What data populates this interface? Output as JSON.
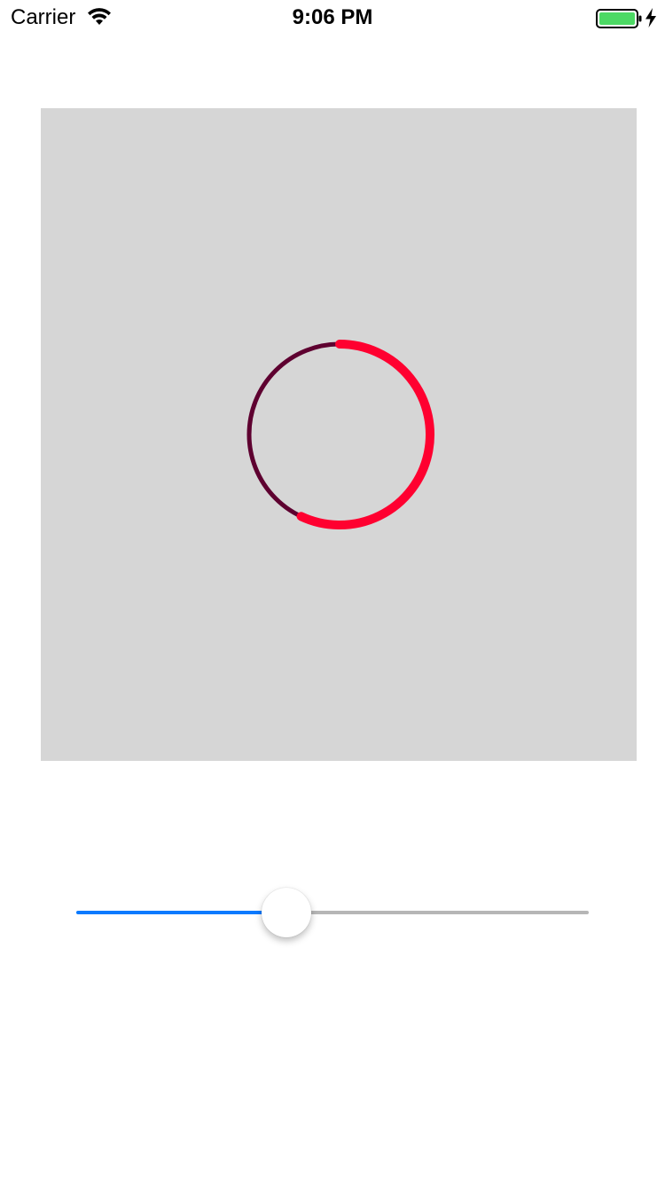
{
  "status_bar": {
    "carrier": "Carrier",
    "time": "9:06 PM",
    "wifi_icon": "wifi-icon",
    "battery_icon": "battery-icon",
    "charging_icon": "lightning-bolt-icon",
    "battery_color": "#4cd964"
  },
  "progress_ring": {
    "progress": 0.57,
    "track_color": "#5e0030",
    "progress_color": "#ff0030"
  },
  "slider": {
    "value": 0.4,
    "min_track_color": "#0a7aff",
    "max_track_color": "#b6b6b6"
  },
  "canvas": {
    "background_color": "#d6d6d6"
  }
}
